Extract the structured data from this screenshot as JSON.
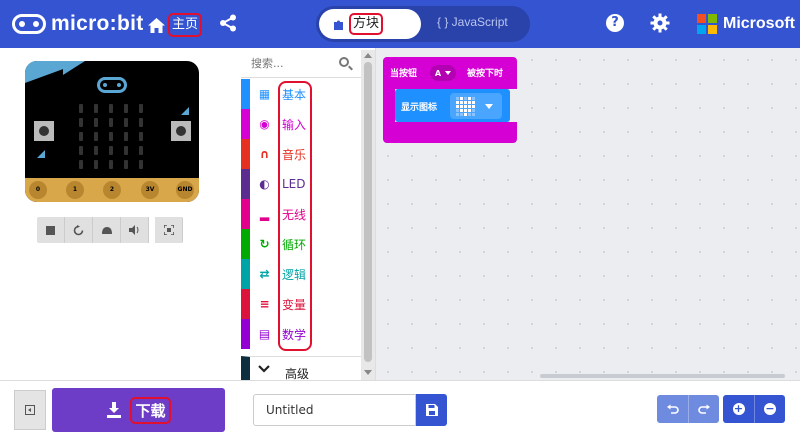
{
  "header": {
    "logo_text": "micro:bit",
    "home_label": "主页",
    "editor_toggle": {
      "blocks_label": "方块",
      "js_label": "{ } JavaScript"
    },
    "help_glyph": "?",
    "brand_text": "Microsoft",
    "colors": {
      "background": "#3454d1"
    }
  },
  "simulator": {
    "pins": [
      "0",
      "1",
      "2",
      "3V",
      "GND"
    ],
    "controls": [
      "stop-icon",
      "restart-icon",
      "slowmo-icon",
      "sound-icon",
      "fullscreen-icon"
    ]
  },
  "toolbox": {
    "search_placeholder": "搜索...",
    "categories": [
      {
        "label": "基本",
        "icon": "grid-icon",
        "color": "#1e90ff"
      },
      {
        "label": "输入",
        "icon": "target-icon",
        "color": "#d400d4"
      },
      {
        "label": "音乐",
        "icon": "headphones-icon",
        "color": "#e63022"
      },
      {
        "label": "LED",
        "icon": "toggle-icon",
        "color": "#5c2d91"
      },
      {
        "label": "无线",
        "icon": "signal-bars-icon",
        "color": "#e3008c"
      },
      {
        "label": "循环",
        "icon": "loop-icon",
        "color": "#00aa00"
      },
      {
        "label": "逻辑",
        "icon": "shuffle-icon",
        "color": "#00a4a6"
      },
      {
        "label": "变量",
        "icon": "lines-icon",
        "color": "#dc143c"
      },
      {
        "label": "数学",
        "icon": "calculator-icon",
        "color": "#9400d3"
      }
    ],
    "advanced_label": "高级"
  },
  "workspace": {
    "event_block": {
      "prefix": "当按钮",
      "button": "A",
      "suffix": "被按下时",
      "color": "#d400d4"
    },
    "show_block": {
      "label": "显示图标",
      "color": "#1e90ff"
    }
  },
  "footer": {
    "download_label": "下载",
    "project_name": "Untitled",
    "download_color": "#6d3dc8"
  }
}
